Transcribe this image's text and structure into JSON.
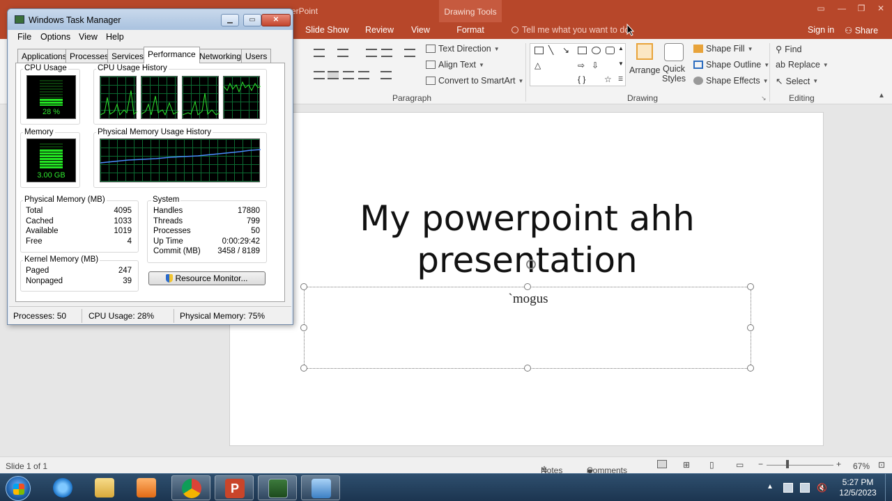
{
  "ppt": {
    "app_title_fragment": "erPoint",
    "context_tab_group": "Drawing Tools",
    "tabs": [
      "Slide Show",
      "Review",
      "View",
      "Format"
    ],
    "tell_me_placeholder": "Tell me what you want to do",
    "sign_in": "Sign in",
    "share": "Share",
    "ribbon": {
      "paragraph": {
        "label": "Paragraph",
        "text_direction": "Text Direction",
        "align_text": "Align Text",
        "convert_smartart": "Convert to SmartArt"
      },
      "drawing": {
        "label": "Drawing",
        "arrange": "Arrange",
        "quick_styles_line1": "Quick",
        "quick_styles_line2": "Styles",
        "shape_fill": "Shape Fill",
        "shape_outline": "Shape Outline",
        "shape_effects": "Shape Effects"
      },
      "editing": {
        "label": "Editing",
        "find": "Find",
        "replace": "Replace",
        "select": "Select"
      }
    },
    "slide": {
      "title_line1": "My powerpoint ahh",
      "title_line2": "presentation",
      "subtitle": "`mogus"
    },
    "status": {
      "slide_info": "Slide 1 of 1",
      "notes": "Notes",
      "comments": "Comments",
      "zoom": "67%"
    }
  },
  "taskmgr": {
    "title": "Windows Task Manager",
    "menu": [
      "File",
      "Options",
      "View",
      "Help"
    ],
    "tabs": [
      "Applications",
      "Processes",
      "Services",
      "Performance",
      "Networking",
      "Users"
    ],
    "active_tab": "Performance",
    "cpu_usage_label": "CPU Usage",
    "cpu_usage_value": "28 %",
    "cpu_usage_fraction": 0.28,
    "cpu_history_label": "CPU Usage History",
    "memory_label": "Memory",
    "memory_value": "3.00 GB",
    "memory_fraction": 0.75,
    "mem_history_label": "Physical Memory Usage History",
    "physical_memory": {
      "header": "Physical Memory (MB)",
      "rows": [
        {
          "label": "Total",
          "value": "4095"
        },
        {
          "label": "Cached",
          "value": "1033"
        },
        {
          "label": "Available",
          "value": "1019"
        },
        {
          "label": "Free",
          "value": "4"
        }
      ]
    },
    "kernel_memory": {
      "header": "Kernel Memory (MB)",
      "rows": [
        {
          "label": "Paged",
          "value": "247"
        },
        {
          "label": "Nonpaged",
          "value": "39"
        }
      ]
    },
    "system": {
      "header": "System",
      "rows": [
        {
          "label": "Handles",
          "value": "17880"
        },
        {
          "label": "Threads",
          "value": "799"
        },
        {
          "label": "Processes",
          "value": "50"
        },
        {
          "label": "Up Time",
          "value": "0:00:29:42"
        },
        {
          "label": "Commit (MB)",
          "value": "3458 / 8189"
        }
      ]
    },
    "resource_monitor_button": "Resource Monitor...",
    "status": {
      "processes": "Processes: 50",
      "cpu_usage": "CPU Usage: 28%",
      "physical_memory": "Physical Memory: 75%"
    }
  },
  "taskbar": {
    "time": "5:27 PM",
    "date": "12/5/2023"
  },
  "colors": {
    "ppt_accent": "#b7472a",
    "meter_green": "#23e623",
    "taskbar": "#1c3550"
  }
}
